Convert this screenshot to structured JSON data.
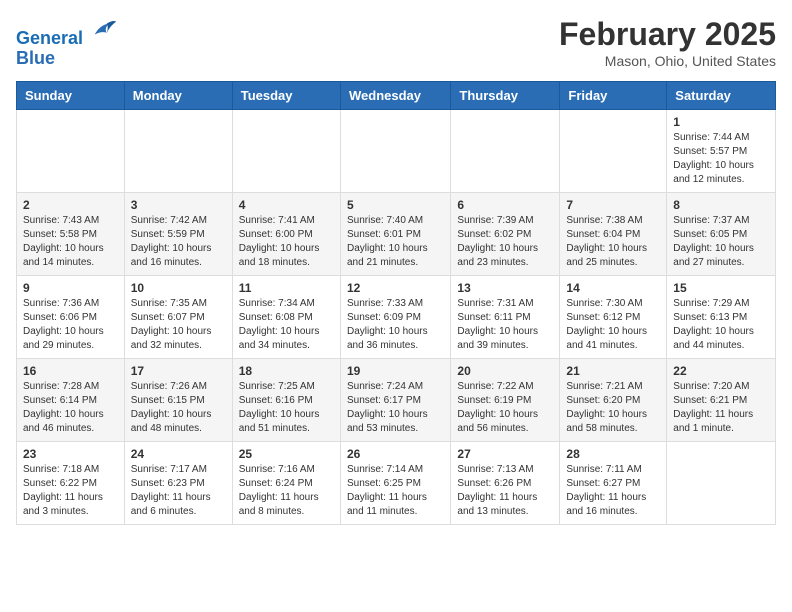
{
  "header": {
    "logo_line1": "General",
    "logo_line2": "Blue",
    "month": "February 2025",
    "location": "Mason, Ohio, United States"
  },
  "weekdays": [
    "Sunday",
    "Monday",
    "Tuesday",
    "Wednesday",
    "Thursday",
    "Friday",
    "Saturday"
  ],
  "weeks": [
    [
      {
        "day": "",
        "info": ""
      },
      {
        "day": "",
        "info": ""
      },
      {
        "day": "",
        "info": ""
      },
      {
        "day": "",
        "info": ""
      },
      {
        "day": "",
        "info": ""
      },
      {
        "day": "",
        "info": ""
      },
      {
        "day": "1",
        "info": "Sunrise: 7:44 AM\nSunset: 5:57 PM\nDaylight: 10 hours\nand 12 minutes."
      }
    ],
    [
      {
        "day": "2",
        "info": "Sunrise: 7:43 AM\nSunset: 5:58 PM\nDaylight: 10 hours\nand 14 minutes."
      },
      {
        "day": "3",
        "info": "Sunrise: 7:42 AM\nSunset: 5:59 PM\nDaylight: 10 hours\nand 16 minutes."
      },
      {
        "day": "4",
        "info": "Sunrise: 7:41 AM\nSunset: 6:00 PM\nDaylight: 10 hours\nand 18 minutes."
      },
      {
        "day": "5",
        "info": "Sunrise: 7:40 AM\nSunset: 6:01 PM\nDaylight: 10 hours\nand 21 minutes."
      },
      {
        "day": "6",
        "info": "Sunrise: 7:39 AM\nSunset: 6:02 PM\nDaylight: 10 hours\nand 23 minutes."
      },
      {
        "day": "7",
        "info": "Sunrise: 7:38 AM\nSunset: 6:04 PM\nDaylight: 10 hours\nand 25 minutes."
      },
      {
        "day": "8",
        "info": "Sunrise: 7:37 AM\nSunset: 6:05 PM\nDaylight: 10 hours\nand 27 minutes."
      }
    ],
    [
      {
        "day": "9",
        "info": "Sunrise: 7:36 AM\nSunset: 6:06 PM\nDaylight: 10 hours\nand 29 minutes."
      },
      {
        "day": "10",
        "info": "Sunrise: 7:35 AM\nSunset: 6:07 PM\nDaylight: 10 hours\nand 32 minutes."
      },
      {
        "day": "11",
        "info": "Sunrise: 7:34 AM\nSunset: 6:08 PM\nDaylight: 10 hours\nand 34 minutes."
      },
      {
        "day": "12",
        "info": "Sunrise: 7:33 AM\nSunset: 6:09 PM\nDaylight: 10 hours\nand 36 minutes."
      },
      {
        "day": "13",
        "info": "Sunrise: 7:31 AM\nSunset: 6:11 PM\nDaylight: 10 hours\nand 39 minutes."
      },
      {
        "day": "14",
        "info": "Sunrise: 7:30 AM\nSunset: 6:12 PM\nDaylight: 10 hours\nand 41 minutes."
      },
      {
        "day": "15",
        "info": "Sunrise: 7:29 AM\nSunset: 6:13 PM\nDaylight: 10 hours\nand 44 minutes."
      }
    ],
    [
      {
        "day": "16",
        "info": "Sunrise: 7:28 AM\nSunset: 6:14 PM\nDaylight: 10 hours\nand 46 minutes."
      },
      {
        "day": "17",
        "info": "Sunrise: 7:26 AM\nSunset: 6:15 PM\nDaylight: 10 hours\nand 48 minutes."
      },
      {
        "day": "18",
        "info": "Sunrise: 7:25 AM\nSunset: 6:16 PM\nDaylight: 10 hours\nand 51 minutes."
      },
      {
        "day": "19",
        "info": "Sunrise: 7:24 AM\nSunset: 6:17 PM\nDaylight: 10 hours\nand 53 minutes."
      },
      {
        "day": "20",
        "info": "Sunrise: 7:22 AM\nSunset: 6:19 PM\nDaylight: 10 hours\nand 56 minutes."
      },
      {
        "day": "21",
        "info": "Sunrise: 7:21 AM\nSunset: 6:20 PM\nDaylight: 10 hours\nand 58 minutes."
      },
      {
        "day": "22",
        "info": "Sunrise: 7:20 AM\nSunset: 6:21 PM\nDaylight: 11 hours\nand 1 minute."
      }
    ],
    [
      {
        "day": "23",
        "info": "Sunrise: 7:18 AM\nSunset: 6:22 PM\nDaylight: 11 hours\nand 3 minutes."
      },
      {
        "day": "24",
        "info": "Sunrise: 7:17 AM\nSunset: 6:23 PM\nDaylight: 11 hours\nand 6 minutes."
      },
      {
        "day": "25",
        "info": "Sunrise: 7:16 AM\nSunset: 6:24 PM\nDaylight: 11 hours\nand 8 minutes."
      },
      {
        "day": "26",
        "info": "Sunrise: 7:14 AM\nSunset: 6:25 PM\nDaylight: 11 hours\nand 11 minutes."
      },
      {
        "day": "27",
        "info": "Sunrise: 7:13 AM\nSunset: 6:26 PM\nDaylight: 11 hours\nand 13 minutes."
      },
      {
        "day": "28",
        "info": "Sunrise: 7:11 AM\nSunset: 6:27 PM\nDaylight: 11 hours\nand 16 minutes."
      },
      {
        "day": "",
        "info": ""
      }
    ]
  ]
}
